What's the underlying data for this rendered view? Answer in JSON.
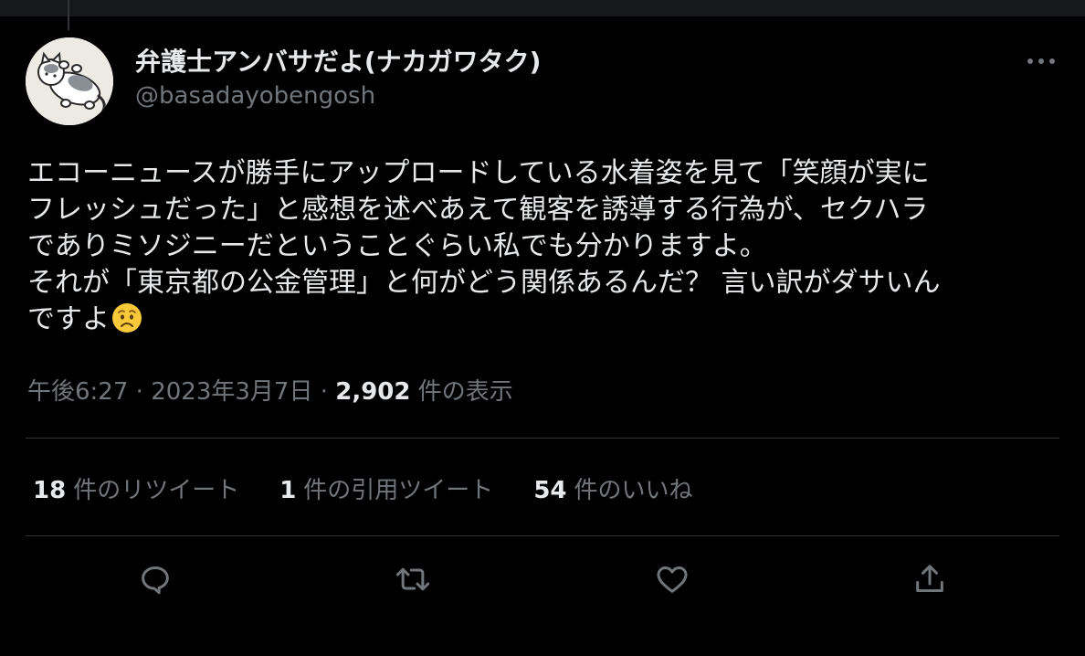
{
  "colors": {
    "background": "#000000",
    "primary_text": "#e7e9ea",
    "secondary_text": "#71767b",
    "divider": "#2f3336"
  },
  "tweet": {
    "author": {
      "display_name": "弁護士アンバサだよ(ナカガワタク)",
      "handle": "@basadayobengosh",
      "avatar_icon": "cat-avatar"
    },
    "more_icon": "more-horizontal-icon",
    "text_lines": [
      "エコーニュースが勝手にアップロードしている水着姿を見て「笑顔が実に",
      "フレッシュだった」と感想を述べあえて観客を誘導する行為が、セクハラ",
      "でありミソジニーだということぐらい私でも分かりますよ。",
      "それが「東京都の公金管理」と何がどう関係あるんだ？ 言い訳がダサいん",
      "ですよ"
    ],
    "emoji": "worried-face-emoji",
    "time": "午後6:27",
    "separator": "·",
    "date": "2023年3月7日",
    "views_count": "2,902",
    "views_label": "件の表示"
  },
  "stats": {
    "retweets": {
      "count": "18",
      "label": "件のリツイート"
    },
    "quotes": {
      "count": "1",
      "label": "件の引用ツイート"
    },
    "likes": {
      "count": "54",
      "label": "件のいいね"
    }
  },
  "actions": [
    {
      "name": "reply",
      "icon": "reply-icon"
    },
    {
      "name": "retweet",
      "icon": "retweet-icon"
    },
    {
      "name": "like",
      "icon": "heart-icon"
    },
    {
      "name": "share",
      "icon": "share-icon"
    }
  ]
}
